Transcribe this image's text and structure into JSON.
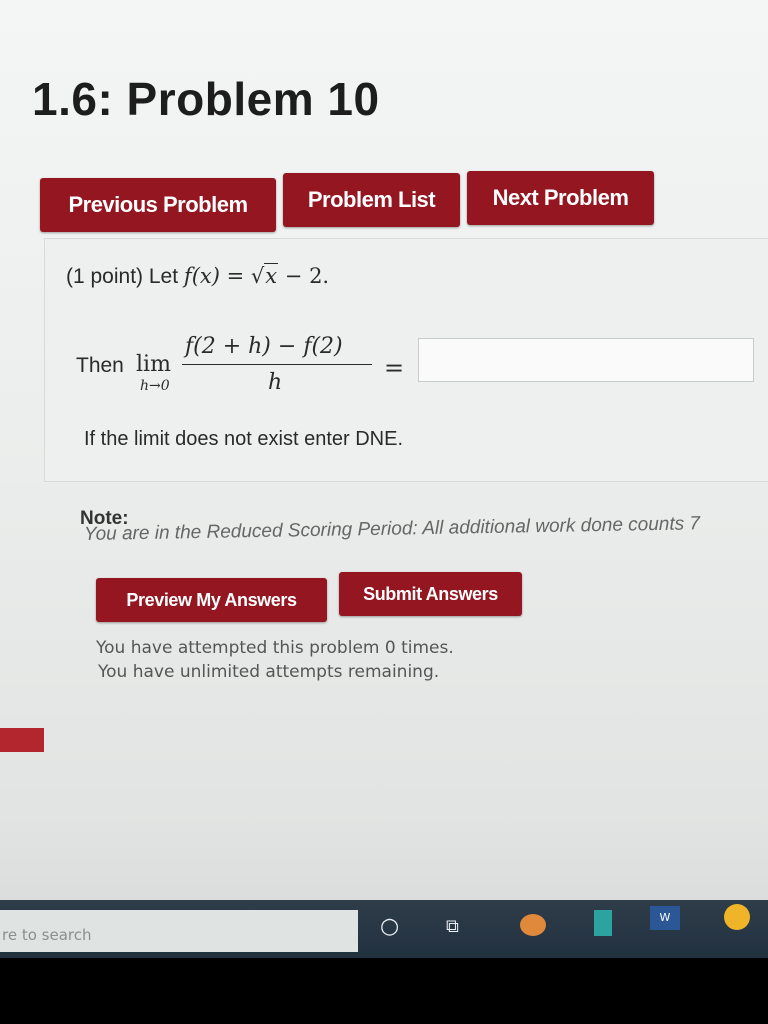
{
  "page": {
    "title": "1.6: Problem 10"
  },
  "nav": {
    "previous": "Previous Problem",
    "list": "Problem List",
    "next": "Next Problem"
  },
  "problem": {
    "points": "(1 point) Let",
    "f_lhs": "f(x) =",
    "sqrt_var": "x",
    "minus_two": " − 2.",
    "then": "Then",
    "lim": "lim",
    "lim_sub": "h→0",
    "numerator": "f(2 + h) − f(2)",
    "denominator": "h",
    "equals": "=",
    "answer_value": "",
    "hint": "If the limit does not exist enter DNE."
  },
  "note": {
    "label": "Note:",
    "text": "You are in the Reduced Scoring Period: All additional work done counts 7"
  },
  "actions": {
    "preview": "Preview My Answers",
    "submit": "Submit Answers"
  },
  "attempts": {
    "line1": "You have attempted this problem 0 times.",
    "line2": "You have unlimited attempts remaining."
  },
  "taskbar": {
    "search": "re to search",
    "icons": [
      "cortana-icon",
      "task-view-icon",
      "app-icon",
      "store-icon",
      "word-icon",
      "chrome-icon"
    ]
  },
  "colors": {
    "button": "#931621",
    "title": "#1d1d1d"
  }
}
